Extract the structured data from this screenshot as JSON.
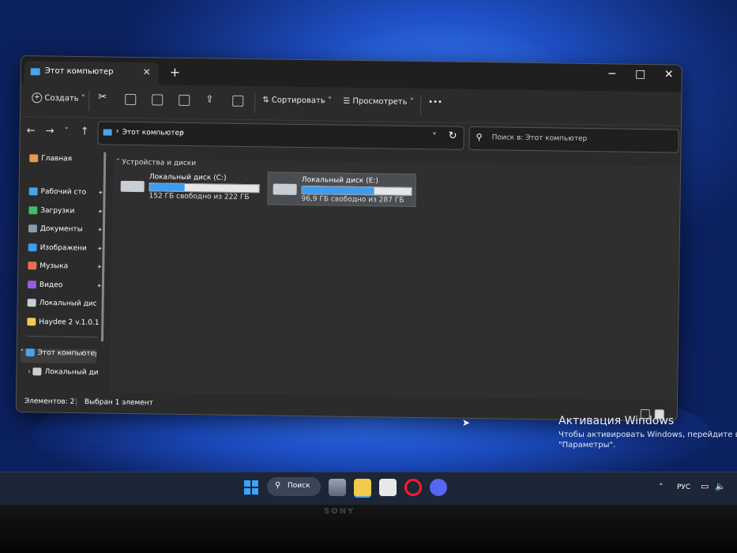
{
  "window": {
    "tab_title": "Этот компьютер",
    "tab_close": "✕",
    "new_tab": "+",
    "minimize": "−",
    "maximize": "□",
    "close": "✕"
  },
  "toolbar": {
    "create_label": "Создать",
    "sort_label": "Сортировать",
    "view_label": "Просмотреть",
    "more_label": "•••"
  },
  "address": {
    "path": "Этот компьютер",
    "search_placeholder": "Поиск в: Этот компьютер"
  },
  "sidebar": {
    "home": "Главная",
    "items": [
      {
        "label": "Рабочий сто",
        "icon": "desktop-icon",
        "color": "#4aa3e8"
      },
      {
        "label": "Загрузки",
        "icon": "download-icon",
        "color": "#3fbf6a"
      },
      {
        "label": "Документы",
        "icon": "documents-icon",
        "color": "#8a9bb0"
      },
      {
        "label": "Изображени",
        "icon": "pictures-icon",
        "color": "#3b9cf0"
      },
      {
        "label": "Музыка",
        "icon": "music-icon",
        "color": "#e8704a"
      },
      {
        "label": "Видео",
        "icon": "video-icon",
        "color": "#9a5ae0"
      },
      {
        "label": "Локальный дис",
        "icon": "drive-icon",
        "color": "#c9ced4"
      },
      {
        "label": "Haydee 2 v.1.0.1",
        "icon": "folder-icon",
        "color": "#f2c94c"
      }
    ],
    "this_pc": "Этот компьютер",
    "local_disk": "Локальный ди"
  },
  "main": {
    "group_label": "Устройства и диски",
    "drives": [
      {
        "name": "Локальный диск (C:)",
        "free_text": "152 ГБ свободно из 222 ГБ",
        "used_fraction": 0.32
      },
      {
        "name": "Локальный диск (E:)",
        "free_text": "96,9 ГБ свободно из 287 ГБ",
        "used_fraction": 0.66
      }
    ]
  },
  "status": {
    "items_count": "Элементов: 2",
    "selected": "Выбран 1 элемент"
  },
  "activation": {
    "title": "Активация Windows",
    "line1": "Чтобы активировать Windows, перейдите в р",
    "line2": "\"Параметры\"."
  },
  "taskbar": {
    "search_label": "Поиск",
    "lang": "РУС"
  },
  "bezel": {
    "brand": "SONY"
  }
}
